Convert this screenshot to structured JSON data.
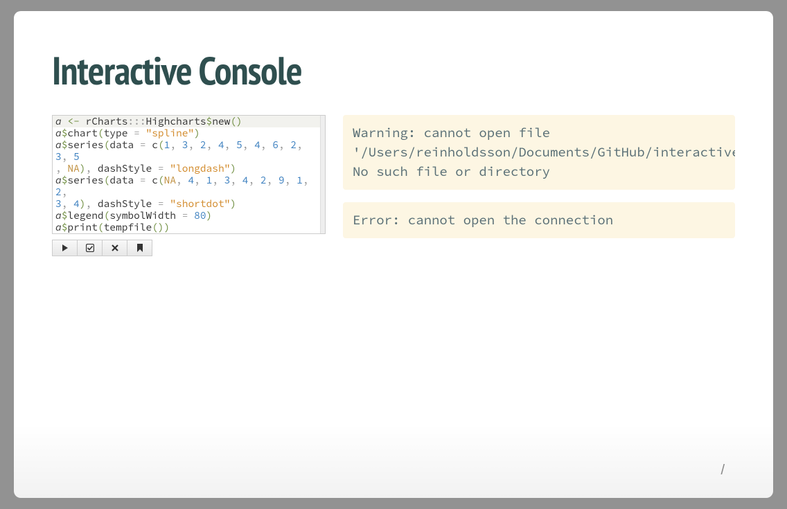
{
  "title": "Interactive Console",
  "code": {
    "l1": {
      "a": "a",
      "arrow": " <- ",
      "rcharts": "rCharts",
      "coloncolon": ":::",
      "highcharts": "Highcharts",
      "dollar": "$",
      "new": "new",
      "op": "(",
      "cp": ")"
    },
    "l2": {
      "a": "a",
      "dollar": "$",
      "chart": "chart",
      "op": "(",
      "type": "type",
      "eq": " = ",
      "spline": "\"spline\"",
      "cp": ")"
    },
    "l3a": {
      "a": "a",
      "dollar": "$",
      "series": "series",
      "op": "(",
      "data": "data",
      "eq": " = ",
      "c": "c",
      "op2": "(",
      "n1": "1",
      "n2": "3",
      "n3": "2",
      "n4": "4",
      "n5": "5",
      "n6": "4",
      "n7": "6",
      "n8": "2",
      "n9": "3",
      "n10": "5"
    },
    "l3b": {
      "na": "NA",
      "cp": ")",
      "dash": "dashStyle",
      "eq": " = ",
      "val": "\"longdash\"",
      "cp2": ")"
    },
    "l4a": {
      "a": "a",
      "dollar": "$",
      "series": "series",
      "op": "(",
      "data": "data",
      "eq": " = ",
      "c": "c",
      "op2": "(",
      "na": "NA",
      "n1": "4",
      "n2": "1",
      "n3": "3",
      "n4": "4",
      "n5": "2",
      "n6": "9",
      "n7": "1",
      "n8": "2"
    },
    "l4b": {
      "n9": "3",
      "n10": "4",
      "cp": ")",
      "dash": "dashStyle",
      "eq": " = ",
      "val": "\"shortdot\"",
      "cp2": ")"
    },
    "l5": {
      "a": "a",
      "dollar": "$",
      "legend": "legend",
      "op": "(",
      "sw": "symbolWidth",
      "eq": " = ",
      "num": "80",
      "cp": ")"
    },
    "l6": {
      "a": "a",
      "dollar": "$",
      "print": "print",
      "op": "(",
      "tf": "tempfile",
      "op2": "(",
      "cp2": ")",
      "cp": ")"
    }
  },
  "toolbar": {
    "run": "run",
    "check": "check",
    "clear": "clear",
    "bookmark": "bookmark"
  },
  "warning": "Warning: cannot open file\n'/Users/reinholdsson/Documents/GitHub/interactive/highcharts':\nNo such file or directory",
  "error": "Error: cannot open the connection",
  "footer": "/"
}
